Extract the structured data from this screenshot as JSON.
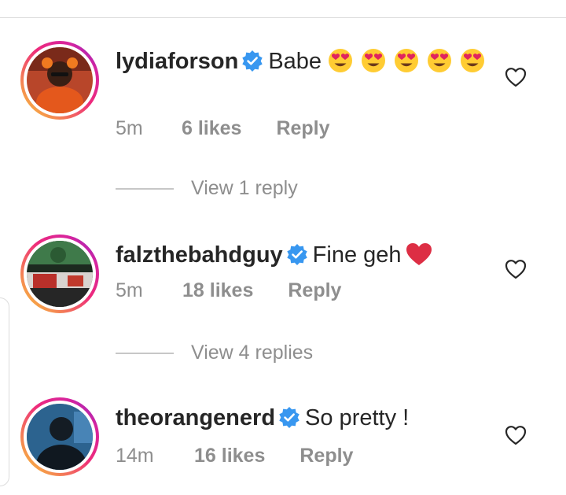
{
  "comments": [
    {
      "username": "lydiaforson",
      "verified": true,
      "text": "Babe",
      "emojis": [
        "heart-eyes-emoji",
        "heart-eyes-emoji",
        "heart-eyes-emoji",
        "heart-eyes-emoji",
        "heart-eyes-emoji"
      ],
      "time": "5m",
      "likes": "6 likes",
      "reply_label": "Reply"
    },
    {
      "username": "falzthebahdguy",
      "verified": true,
      "text": "Fine geh",
      "emojis": [
        "red-heart-emoji"
      ],
      "time": "5m",
      "likes": "18 likes",
      "reply_label": "Reply"
    },
    {
      "username": "theorangenerd",
      "verified": true,
      "text": "So pretty !",
      "emojis": [],
      "time": "14m",
      "likes": "16 likes",
      "reply_label": "Reply"
    }
  ],
  "view_replies": [
    {
      "label": "View 1 reply"
    },
    {
      "label": "View 4 replies"
    }
  ],
  "colors": {
    "text": "#262626",
    "meta": "#8e8e8e",
    "verified": "#3897f0",
    "heart": "#e0245e"
  }
}
